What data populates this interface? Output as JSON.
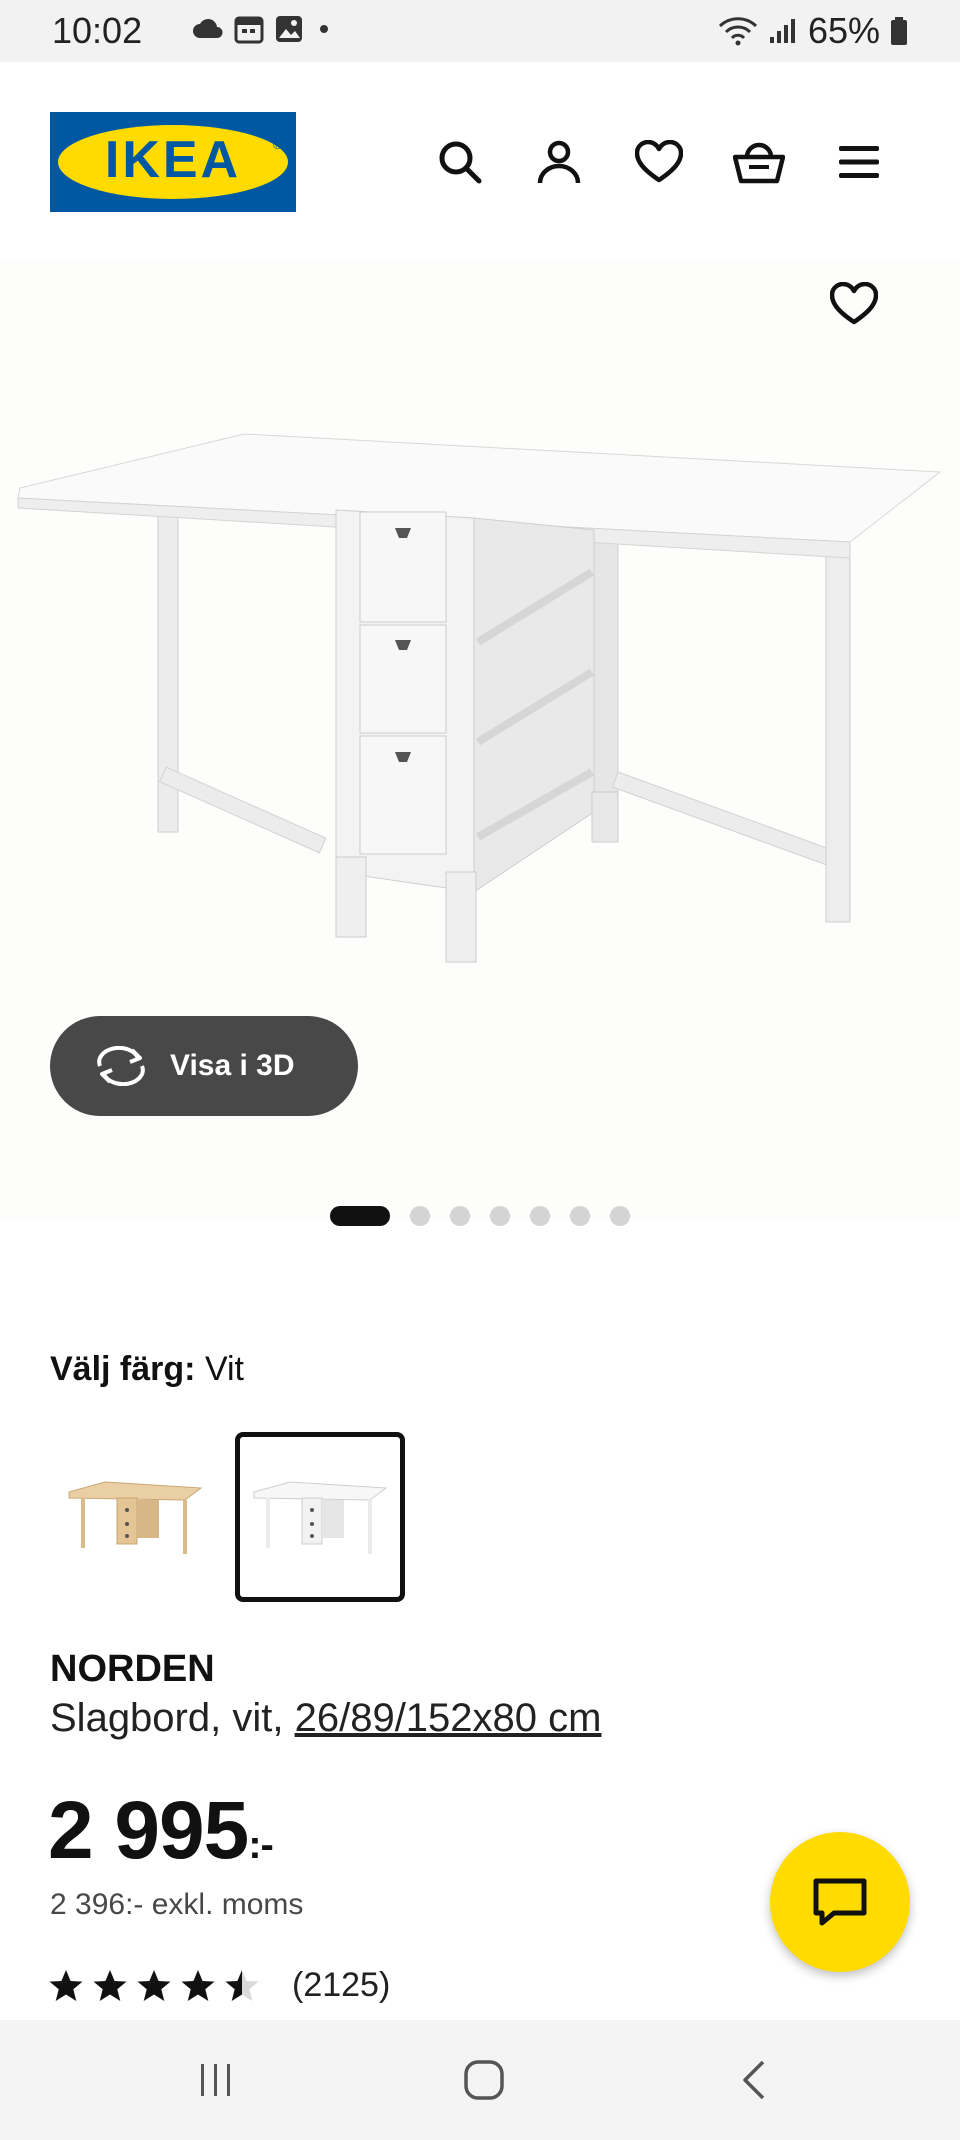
{
  "status_bar": {
    "time": "10:02",
    "battery": "65%"
  },
  "header": {
    "brand": "IKEA",
    "brand_reg": "®"
  },
  "gallery": {
    "view_3d_label": "Visa i 3D",
    "image_count": 7,
    "active_image": 1
  },
  "color": {
    "label": "Välj färg:",
    "value": "Vit",
    "options": [
      "björk",
      "vit"
    ],
    "selected": "vit"
  },
  "product": {
    "name": "NORDEN",
    "type_prefix": "Slagbord, vit,",
    "dimensions": "26/89/152x80 cm",
    "price_main": "2 995",
    "price_suffix": ":-",
    "price_ex_vat": "2 396:- exkl. moms",
    "rating_value": 4.5,
    "rating_max": 5,
    "review_count": "(2125)"
  },
  "colors": {
    "ikea_blue": "#0058a3",
    "ikea_yellow": "#ffdb00",
    "button_dark": "#484848"
  }
}
